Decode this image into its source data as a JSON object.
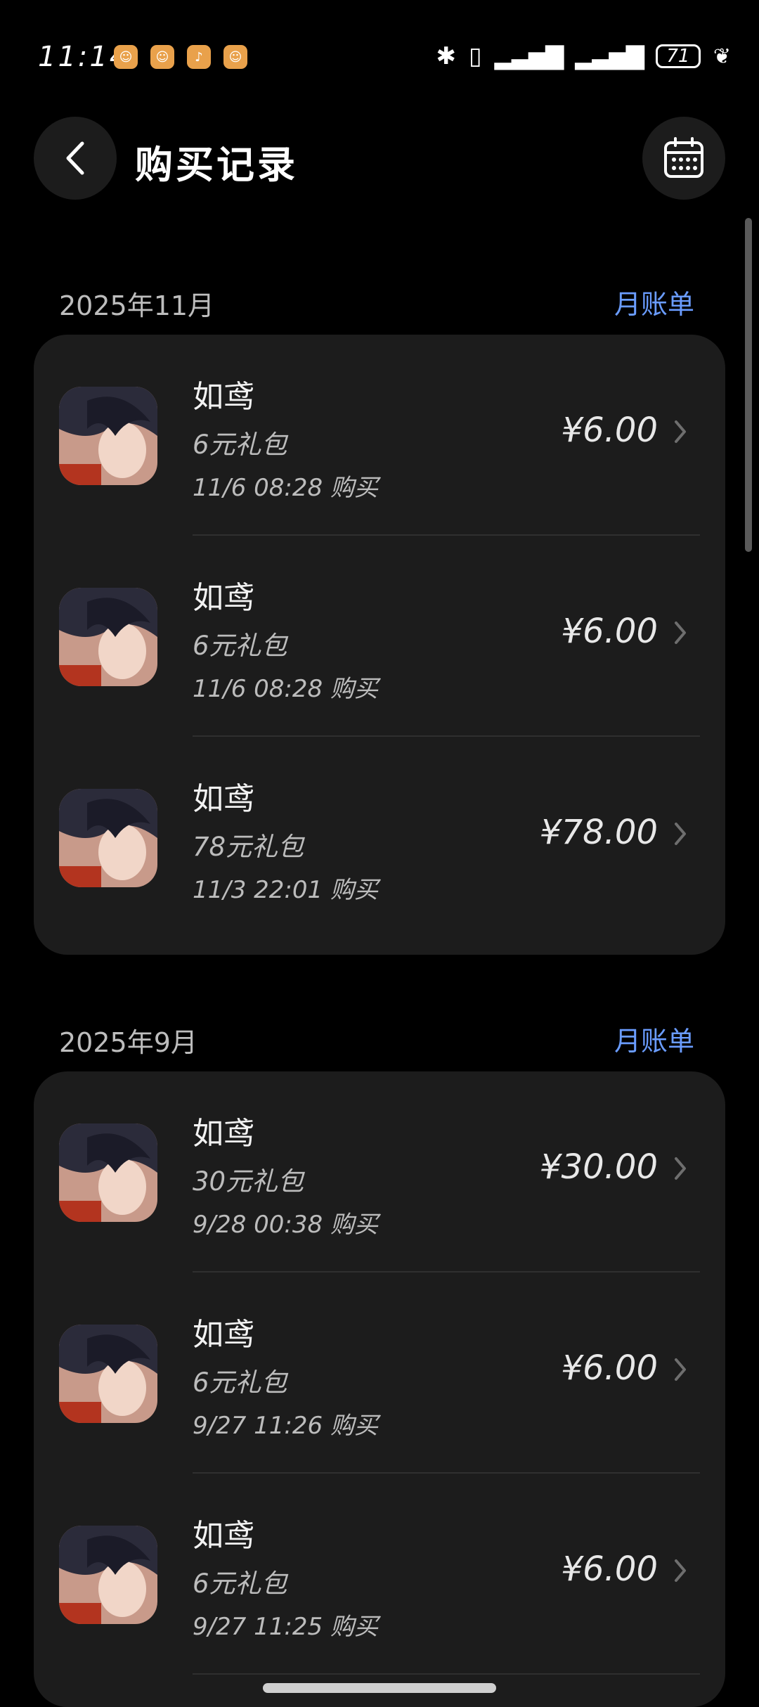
{
  "status_bar": {
    "time": "11:14",
    "battery": "71",
    "icons": [
      "notification-icon",
      "notification-icon",
      "tiktok-icon",
      "notification-icon",
      "bluetooth-icon",
      "vibrate-icon",
      "signal-icon",
      "signal-icon",
      "battery-icon",
      "leaf-icon"
    ]
  },
  "header": {
    "title": "购买记录",
    "back_icon": "chevron-left-icon",
    "calendar_icon": "calendar-icon"
  },
  "colors": {
    "background": "#000000",
    "card": "#1c1c1c",
    "accent": "#6a9cff"
  },
  "sections": [
    {
      "month": "2025年11月",
      "bill_link": "月账单",
      "items": [
        {
          "title": "如鸢",
          "subtitle": "6元礼包",
          "time": "11/6 08:28  购买",
          "price": "¥6.00"
        },
        {
          "title": "如鸢",
          "subtitle": "6元礼包",
          "time": "11/6 08:28  购买",
          "price": "¥6.00"
        },
        {
          "title": "如鸢",
          "subtitle": "78元礼包",
          "time": "11/3 22:01  购买",
          "price": "¥78.00"
        }
      ]
    },
    {
      "month": "2025年9月",
      "bill_link": "月账单",
      "items": [
        {
          "title": "如鸢",
          "subtitle": "30元礼包",
          "time": "9/28 00:38  购买",
          "price": "¥30.00"
        },
        {
          "title": "如鸢",
          "subtitle": "6元礼包",
          "time": "9/27 11:26  购买",
          "price": "¥6.00"
        },
        {
          "title": "如鸢",
          "subtitle": "6元礼包",
          "time": "9/27 11:25  购买",
          "price": "¥6.00"
        }
      ]
    }
  ]
}
